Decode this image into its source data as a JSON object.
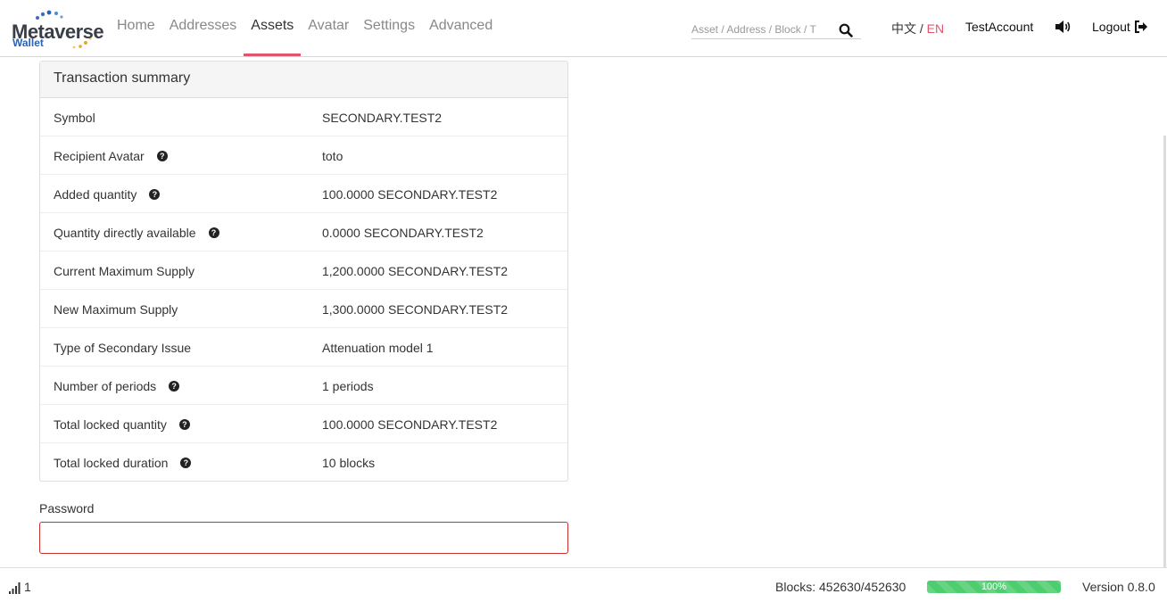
{
  "logo": {
    "title": "Metaverse",
    "subtitle": "Wallet"
  },
  "nav": {
    "items": [
      {
        "label": "Home"
      },
      {
        "label": "Addresses"
      },
      {
        "label": "Assets"
      },
      {
        "label": "Avatar"
      },
      {
        "label": "Settings"
      },
      {
        "label": "Advanced"
      }
    ],
    "active_index": 2
  },
  "search": {
    "placeholder": "Asset / Address / Block / T",
    "icon": "search-icon"
  },
  "language": {
    "zh": "中文",
    "separator": "/",
    "en": "EN"
  },
  "account": {
    "name": "TestAccount"
  },
  "logout": {
    "label": "Logout"
  },
  "summary": {
    "title": "Transaction summary",
    "rows": [
      {
        "label": "Symbol",
        "value": "SECONDARY.TEST2",
        "help": false
      },
      {
        "label": "Recipient Avatar",
        "value": "toto",
        "help": true
      },
      {
        "label": "Added quantity",
        "value": "100.0000 SECONDARY.TEST2",
        "help": true
      },
      {
        "label": "Quantity directly available",
        "value": "0.0000 SECONDARY.TEST2",
        "help": true
      },
      {
        "label": "Current Maximum Supply",
        "value": "1,200.0000 SECONDARY.TEST2",
        "help": false
      },
      {
        "label": "New Maximum Supply",
        "value": "1,300.0000 SECONDARY.TEST2",
        "help": false
      },
      {
        "label": "Type of Secondary Issue",
        "value": "Attenuation model 1",
        "help": false
      },
      {
        "label": "Number of periods",
        "value": "1 periods",
        "help": true
      },
      {
        "label": "Total locked quantity",
        "value": "100.0000 SECONDARY.TEST2",
        "help": true
      },
      {
        "label": "Total locked duration",
        "value": "10 blocks",
        "help": true
      }
    ]
  },
  "password": {
    "label": "Password",
    "value": ""
  },
  "footer": {
    "peers": "1",
    "blocks": "Blocks: 452630/452630",
    "sync_progress": 100,
    "sync_label": "100%",
    "version": "Version 0.8.0"
  },
  "colors": {
    "accent": "#e0546e",
    "brand_blue": "#2a63b5",
    "progress": "#4ccd6e",
    "error_border": "#c9302c"
  }
}
